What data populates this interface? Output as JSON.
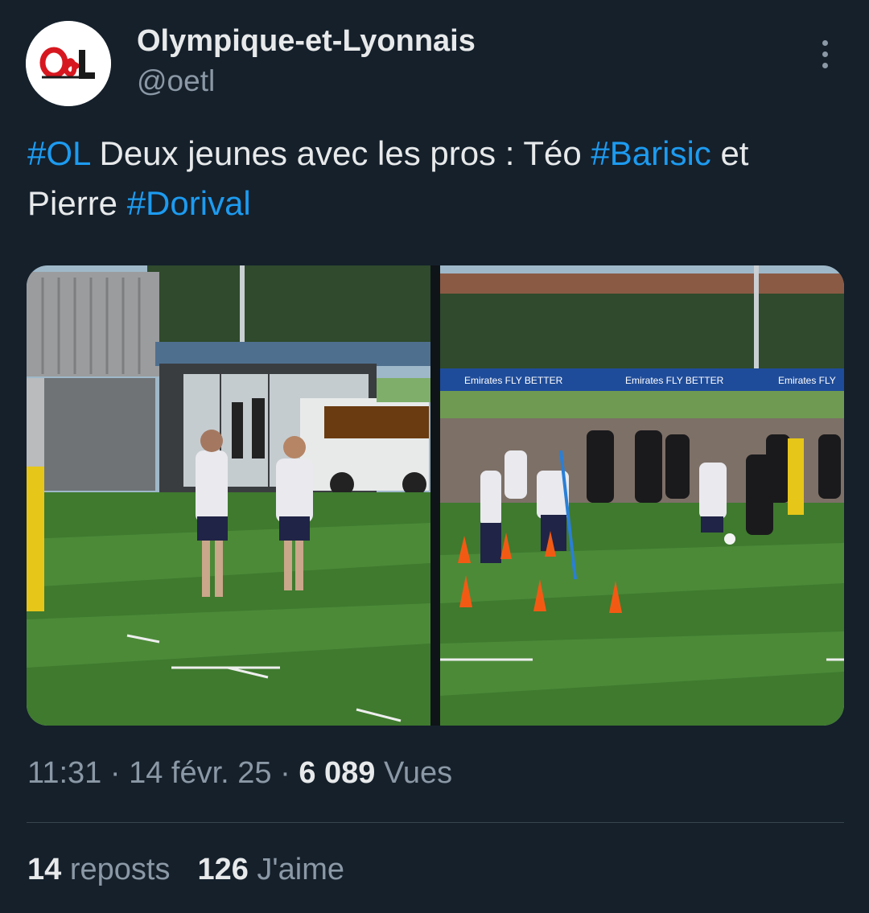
{
  "author": {
    "display_name": "Olympique-et-Lyonnais",
    "handle": "@oetl",
    "avatar_logo_text": "O&L"
  },
  "tweet": {
    "hashtag_ol": "#OL",
    "text_1": " Deux jeunes avec les pros : Téo ",
    "hashtag_barisic": "#Barisic",
    "text_2": " et Pierre ",
    "hashtag_dorival": "#Dorival"
  },
  "media": {
    "banner_text_1": "Emirates FLY BETTER",
    "banner_text_2": "Emirates FLY BETTER",
    "banner_text_3": "Emirates FLY"
  },
  "meta": {
    "time": "11:31",
    "sep1": " · ",
    "date": "14 févr. 25",
    "sep2": " · ",
    "views_count": "6 089",
    "views_label": " Vues"
  },
  "stats": {
    "reposts_count": "14",
    "reposts_label": " reposts",
    "likes_count": "126",
    "likes_label": " J'aime"
  },
  "colors": {
    "background": "#15202b",
    "hashtag": "#1d9bf0",
    "muted": "#8b98a5",
    "text": "#e7e9ea",
    "logo_red": "#d7171f"
  },
  "icons": {
    "more": "more-vertical-icon"
  }
}
